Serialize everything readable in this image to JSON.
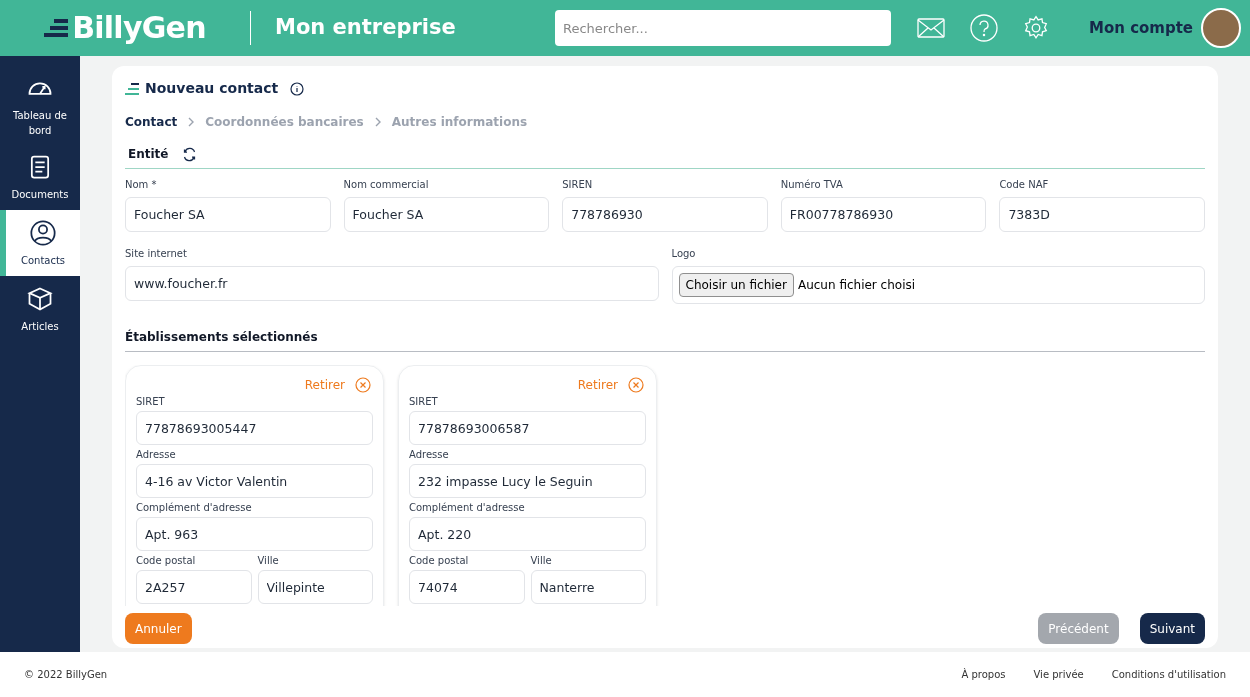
{
  "header": {
    "logo": "BillyGen",
    "company": "Mon entreprise",
    "search": {
      "placeholder": "Rechercher..."
    },
    "account": "Mon compte"
  },
  "sidebar": {
    "items": [
      {
        "kind": "dashboard",
        "label": "Tableau de bord",
        "selected": false
      },
      {
        "kind": "documents",
        "label": "Documents",
        "selected": false
      },
      {
        "kind": "contacts",
        "label": "Contacts",
        "selected": true
      },
      {
        "kind": "articles",
        "label": "Articles",
        "selected": false
      }
    ]
  },
  "title": "Nouveau contact",
  "steps": [
    {
      "label": "Contact",
      "selected": true
    },
    {
      "label": "Coordonnées bancaires",
      "selected": false
    },
    {
      "label": "Autres informations",
      "selected": false
    }
  ],
  "entity": {
    "title": "Entité",
    "fields": [
      {
        "label": "Nom *",
        "value": "Foucher SA"
      },
      {
        "label": "Nom commercial",
        "value": "Foucher SA"
      },
      {
        "label": "SIREN",
        "value": "778786930"
      },
      {
        "label": "Numéro TVA",
        "value": "FR00778786930"
      },
      {
        "label": "Code NAF",
        "value": "7383D"
      }
    ],
    "website": {
      "label": "Site internet",
      "value": "www.foucher.fr"
    },
    "logo": {
      "label": "Logo",
      "button": "Choisir un fichier",
      "status": "Aucun fichier choisi"
    }
  },
  "establishments": {
    "title": "Établissements sélectionnés",
    "items": [
      {
        "remove": "Retirer",
        "siret_label": "SIRET",
        "siret": "77878693005447",
        "address_label": "Adresse",
        "address": "4-16 av Victor Valentin",
        "complement_label": "Complément d'adresse",
        "complement": "Apt. 963",
        "postal_label": "Code postal",
        "postal": "2A257",
        "city_label": "Ville",
        "city": "Villepinte"
      },
      {
        "remove": "Retirer",
        "siret_label": "SIRET",
        "siret": "77878693006587",
        "address_label": "Adresse",
        "address": "232 impasse Lucy le Seguin",
        "complement_label": "Complément d'adresse",
        "complement": "Apt. 220",
        "postal_label": "Code postal",
        "postal": "74074",
        "city_label": "Ville",
        "city": "Nanterre"
      }
    ]
  },
  "actions": {
    "cancel": "Annuler",
    "previous": "Précédent",
    "next": "Suivant"
  },
  "footer": {
    "copyright": "© 2022 BillyGen",
    "links": [
      "À propos",
      "Vie privée",
      "Conditions d'utilisation"
    ]
  }
}
